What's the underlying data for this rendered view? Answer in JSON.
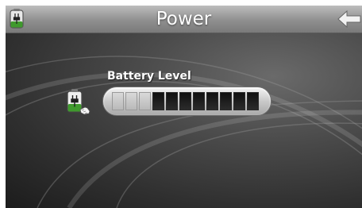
{
  "header": {
    "title": "Power",
    "power_icon": "battery-plug-icon",
    "back_icon": "back-arrow-icon"
  },
  "battery": {
    "label": "Battery Level",
    "icon": "battery-plug-icon",
    "segments_total": 11,
    "segments_filled": 8,
    "level_fraction": 0.73
  },
  "colors": {
    "background": "#3a3a3a",
    "titlebar": "#9a9a9a",
    "segment_filled": "#111111",
    "segment_empty": "#cfcfcf"
  }
}
